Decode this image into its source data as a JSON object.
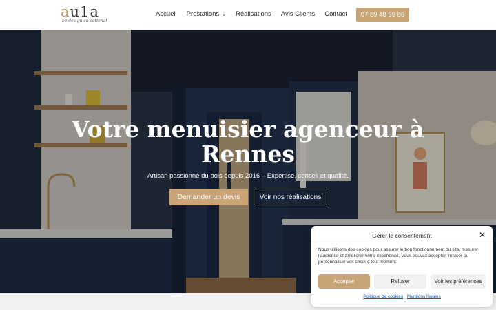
{
  "brand": {
    "logo_letter": "a",
    "logo_rest": "u1a",
    "tagline": "be design en cettenal"
  },
  "nav": {
    "items": [
      {
        "label": "Accueil"
      },
      {
        "label": "Prestations",
        "has_dropdown": true
      },
      {
        "label": "Réalisations"
      },
      {
        "label": "Avis Clients"
      },
      {
        "label": "Contact"
      }
    ],
    "phone": "07 89 48 59 86"
  },
  "hero": {
    "title_line1": "Votre menuisier agenceur à",
    "title_line2": "Rennes",
    "subtitle": "Artisan passionné du bois depuis 2016 – Expertise, conseil et qualité.",
    "cta_primary": "Demander un devis",
    "cta_secondary": "Voir nos réalisations"
  },
  "cookie": {
    "title": "Gérer le consentement",
    "body": "Nous utilisons des cookies pour assurer le bon fonctionnement du site, mesurer l'audience et améliorer votre expérience. Vous pouvez accepter, refuser ou personnaliser vos choix à tout moment.",
    "accept": "Accepter",
    "refuse": "Refuser",
    "preferences": "Voir les préférences",
    "link_cookies": "Politique de cookies",
    "link_legal": "Mentions légales"
  },
  "colors": {
    "accent": "#c8a476",
    "cabinet_blue": "#1d2c46",
    "text_dark": "#2f2f2f",
    "link_blue": "#1a5fb4"
  }
}
